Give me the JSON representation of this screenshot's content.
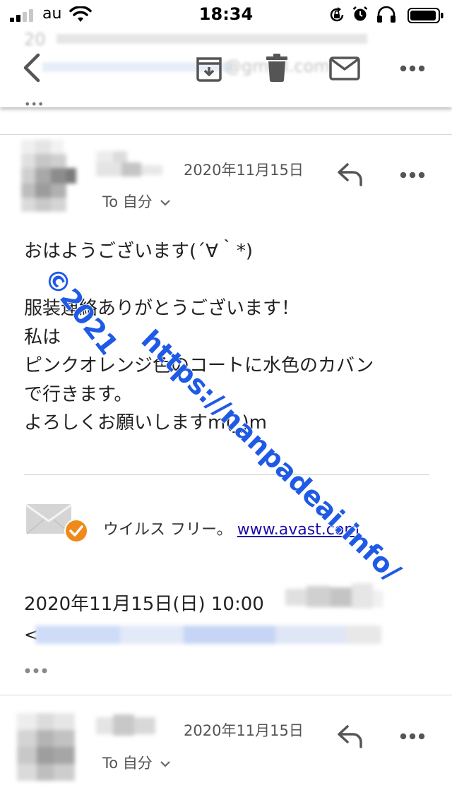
{
  "status_bar": {
    "carrier": "au",
    "time": "18:34"
  },
  "toolbar": {
    "ghost_line_1": "20",
    "ghost_line_2": "@gmail.com",
    "ghost_line_3": "•••"
  },
  "email1": {
    "date": "2020年11月15日",
    "to_label": "To 自分",
    "body": [
      "おはようございます(´∀｀*)",
      "",
      "服装連絡ありがとうございます！",
      "私は",
      "ピンクオレンジ色のコートに水色のカバン",
      "で行きます。",
      "よろしくお願いしますm(_)m"
    ],
    "signature_text": "ウイルス フリー。",
    "signature_link": "www.avast.com",
    "quote_header": "2020年11月15日(日) 10:00",
    "quote_email_prefix": "<"
  },
  "email2": {
    "date": "2020年11月15日",
    "to_label": "To 自分"
  },
  "watermark": {
    "line1": "©2021",
    "line2": "https://nanpadeai.info/"
  },
  "colors": {
    "accent_link": "#1a0dab",
    "watermark": "#1e5ae6",
    "badge": "#ef8a1a",
    "icon_gray": "#555555"
  }
}
